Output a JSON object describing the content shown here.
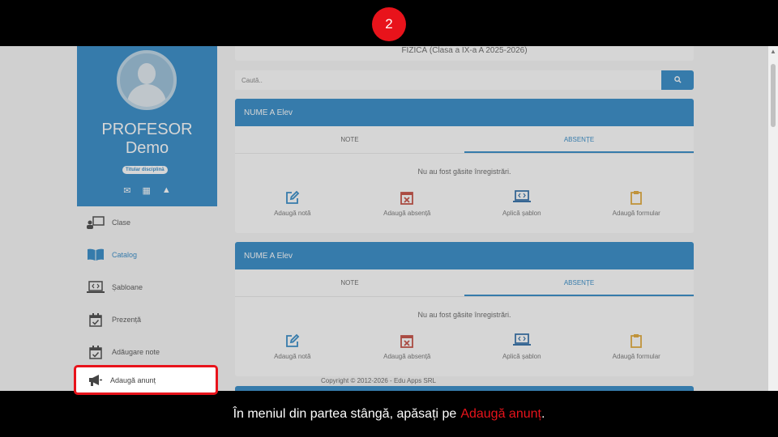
{
  "step": "2",
  "caption": {
    "text": "În meniul din partea stângă, apăsați pe",
    "highlight": "Adaugă anunț",
    "end": "."
  },
  "header": {
    "subject": "FIZICĂ (Clasa a IX-a A 2025-2026)"
  },
  "search": {
    "placeholder": "Caută..",
    "icon": "search-icon"
  },
  "profile": {
    "name_line1": "PROFESOR",
    "name_line2": "Demo",
    "badge": "Titular disciplină"
  },
  "menu": [
    {
      "label": "Clase",
      "icon": "classroom-icon"
    },
    {
      "label": "Catalog",
      "icon": "book-icon"
    },
    {
      "label": "Șabloane",
      "icon": "template-icon"
    },
    {
      "label": "Prezență",
      "icon": "calendar-check-icon"
    },
    {
      "label": "Adăugare note",
      "icon": "calendar-check-icon"
    },
    {
      "label": "Adaugă anunț",
      "icon": "megaphone-icon"
    }
  ],
  "students": [
    {
      "name": "NUME A Elev",
      "tabs": [
        "NOTE",
        "ABSENȚE"
      ],
      "empty": "Nu au fost găsite înregistrări.",
      "actions": [
        "Adaugă notă",
        "Adaugă absență",
        "Aplică șablon",
        "Adaugă formular"
      ]
    },
    {
      "name": "NUME A Elev",
      "tabs": [
        "NOTE",
        "ABSENȚE"
      ],
      "empty": "Nu au fost găsite înregistrări.",
      "actions": [
        "Adaugă notă",
        "Adaugă absență",
        "Aplică șablon",
        "Adaugă formular"
      ]
    }
  ],
  "footer": "Copyright © 2012-2026 - Edu Apps SRL",
  "colors": {
    "primary": "#1a7dc2",
    "highlight": "#e8131b",
    "action_edit": "#1a7dc2",
    "action_absence": "#c0392b",
    "action_template": "#1a5fa0",
    "action_form": "#e0a020"
  }
}
